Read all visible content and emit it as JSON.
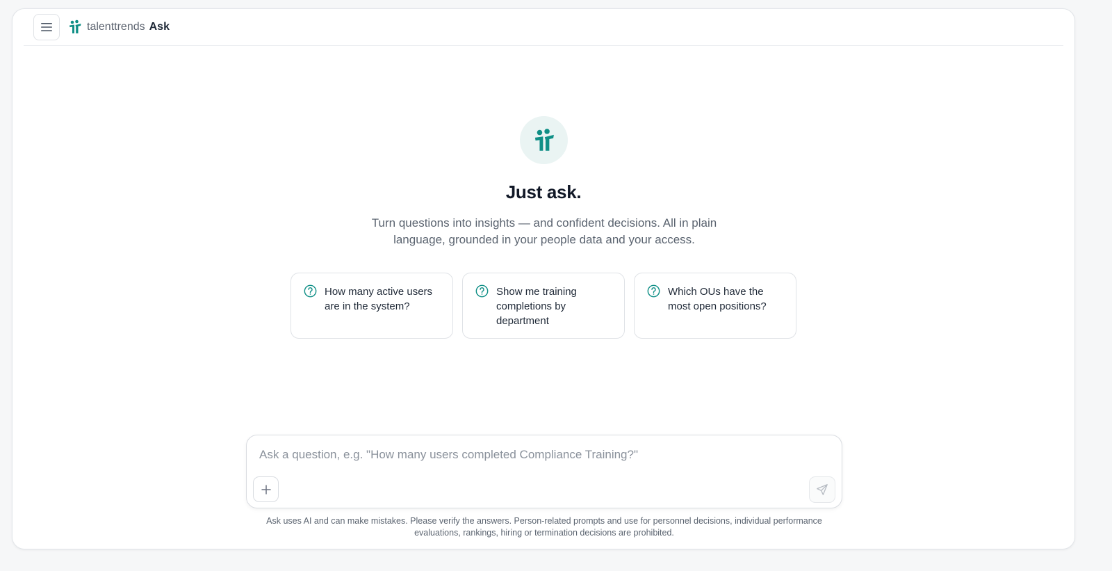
{
  "header": {
    "brand_name": "talenttrends",
    "product_name": "Ask",
    "menu_icon": "hamburger-menu-icon",
    "logo_icon": "talenttrends-logo-icon"
  },
  "hero": {
    "icon": "talenttrends-logo-icon",
    "title": "Just ask.",
    "subtitle": "Turn questions into insights — and confident decisions. All in plain language, grounded in your people data and your access."
  },
  "suggestions": [
    {
      "icon": "question-circle-icon",
      "text": "How many active users are in the system?"
    },
    {
      "icon": "question-circle-icon",
      "text": "Show me training completions by department"
    },
    {
      "icon": "question-circle-icon",
      "text": "Which OUs have the most open positions?"
    }
  ],
  "composer": {
    "value": "",
    "placeholder": "Ask a question, e.g. \"How many users completed Compliance Training?\"",
    "add_icon": "plus-icon",
    "send_icon": "send-icon"
  },
  "disclaimer": "Ask uses AI and can make mistakes. Please verify the answers. Person-related prompts and use for personnel decisions, individual performance evaluations, rankings, hiring or termination decisions are prohibited.",
  "colors": {
    "accent": "#0f8f86",
    "accent_soft": "#eaf4f3",
    "text": "#1f2937",
    "muted": "#5b6470",
    "border": "#dfe2e6"
  }
}
